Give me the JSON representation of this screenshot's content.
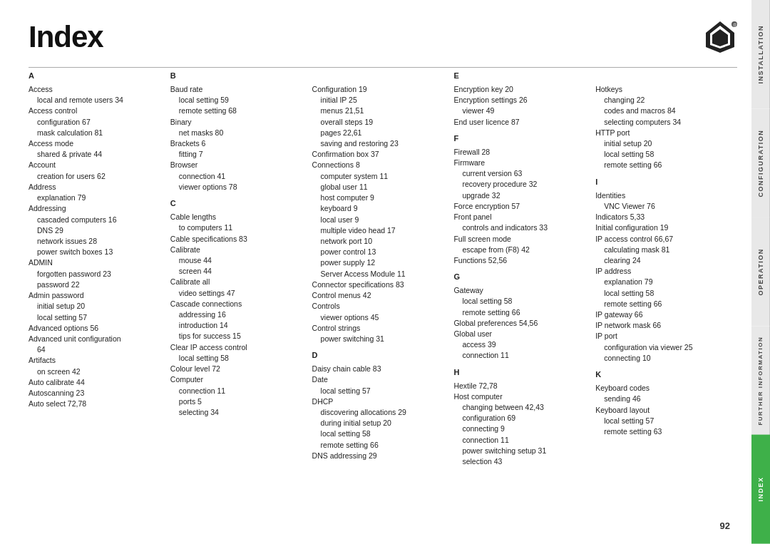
{
  "page": {
    "title": "Index",
    "page_number": "92"
  },
  "tabs": [
    {
      "label": "INSTALLATION",
      "id": "installation",
      "active": false
    },
    {
      "label": "CONFIGURATION",
      "id": "configuration",
      "active": false
    },
    {
      "label": "OPERATION",
      "id": "operation",
      "active": false
    },
    {
      "label": "FURTHER INFORMATION",
      "id": "further-information",
      "active": false
    },
    {
      "label": "INDEX",
      "id": "index",
      "active": true
    }
  ],
  "columns": [
    {
      "id": "col1",
      "sections": [
        {
          "letter": "A",
          "entries": [
            {
              "text": "Access",
              "indent": 0
            },
            {
              "text": "local and remote users  34",
              "indent": 1
            },
            {
              "text": "Access control",
              "indent": 0
            },
            {
              "text": "configuration  67",
              "indent": 1
            },
            {
              "text": "mask calculation  81",
              "indent": 1
            },
            {
              "text": "Access mode",
              "indent": 0
            },
            {
              "text": "shared & private  44",
              "indent": 1
            },
            {
              "text": "Account",
              "indent": 0
            },
            {
              "text": "creation for users  62",
              "indent": 1
            },
            {
              "text": "Address",
              "indent": 0
            },
            {
              "text": "explanation  79",
              "indent": 1
            },
            {
              "text": "Addressing",
              "indent": 0
            },
            {
              "text": "cascaded computers  16",
              "indent": 1
            },
            {
              "text": "DNS  29",
              "indent": 1
            },
            {
              "text": "network issues  28",
              "indent": 1
            },
            {
              "text": "power switch boxes  13",
              "indent": 1
            },
            {
              "text": "ADMIN",
              "indent": 0
            },
            {
              "text": "forgotten password  23",
              "indent": 1
            },
            {
              "text": "password  22",
              "indent": 1
            },
            {
              "text": "Admin password",
              "indent": 0
            },
            {
              "text": "initial setup  20",
              "indent": 1
            },
            {
              "text": "local setting  57",
              "indent": 1
            },
            {
              "text": "Advanced options  56",
              "indent": 0
            },
            {
              "text": "Advanced unit configuration",
              "indent": 0
            },
            {
              "text": "64",
              "indent": 1
            },
            {
              "text": "Artifacts",
              "indent": 0
            },
            {
              "text": "on screen  42",
              "indent": 1
            },
            {
              "text": "Auto calibrate  44",
              "indent": 0
            },
            {
              "text": "Autoscanning  23",
              "indent": 0
            },
            {
              "text": "Auto select  72,78",
              "indent": 0
            }
          ]
        }
      ]
    },
    {
      "id": "col2",
      "sections": [
        {
          "letter": "B",
          "entries": [
            {
              "text": "Baud rate",
              "indent": 0
            },
            {
              "text": "local setting  59",
              "indent": 1
            },
            {
              "text": "remote setting  68",
              "indent": 1
            },
            {
              "text": "Binary",
              "indent": 0
            },
            {
              "text": "net masks  80",
              "indent": 1
            },
            {
              "text": "Brackets  6",
              "indent": 0
            },
            {
              "text": "fitting  7",
              "indent": 1
            },
            {
              "text": "Browser",
              "indent": 0
            },
            {
              "text": "connection  41",
              "indent": 1
            },
            {
              "text": "viewer options  78",
              "indent": 1
            }
          ]
        },
        {
          "letter": "C",
          "entries": [
            {
              "text": "Cable lengths",
              "indent": 0
            },
            {
              "text": "to computers  11",
              "indent": 1
            },
            {
              "text": "Cable specifications  83",
              "indent": 0
            },
            {
              "text": "Calibrate",
              "indent": 0
            },
            {
              "text": "mouse  44",
              "indent": 1
            },
            {
              "text": "screen  44",
              "indent": 1
            },
            {
              "text": "Calibrate all",
              "indent": 0
            },
            {
              "text": "video settings  47",
              "indent": 1
            },
            {
              "text": "Cascade connections",
              "indent": 0
            },
            {
              "text": "addressing  16",
              "indent": 1
            },
            {
              "text": "introduction  14",
              "indent": 1
            },
            {
              "text": "tips for success  15",
              "indent": 1
            },
            {
              "text": "Clear IP access control",
              "indent": 0
            },
            {
              "text": "local setting  58",
              "indent": 1
            },
            {
              "text": "Colour level  72",
              "indent": 0
            },
            {
              "text": "Computer",
              "indent": 0
            },
            {
              "text": "connection  11",
              "indent": 1
            },
            {
              "text": "ports  5",
              "indent": 1
            },
            {
              "text": "selecting  34",
              "indent": 1
            }
          ]
        }
      ]
    },
    {
      "id": "col3",
      "sections": [
        {
          "letter": "",
          "entries": [
            {
              "text": "Configuration  19",
              "indent": 0
            },
            {
              "text": "initial IP  25",
              "indent": 1
            },
            {
              "text": "menus  21,51",
              "indent": 1
            },
            {
              "text": "overall steps  19",
              "indent": 1
            },
            {
              "text": "pages  22,61",
              "indent": 1
            },
            {
              "text": "saving and restoring  23",
              "indent": 1
            },
            {
              "text": "Confirmation box  37",
              "indent": 0
            },
            {
              "text": "Connections  8",
              "indent": 0
            },
            {
              "text": "computer system  11",
              "indent": 1
            },
            {
              "text": "global user  11",
              "indent": 1
            },
            {
              "text": "host computer  9",
              "indent": 1
            },
            {
              "text": "keyboard  9",
              "indent": 1
            },
            {
              "text": "local user  9",
              "indent": 1
            },
            {
              "text": "multiple video head  17",
              "indent": 1
            },
            {
              "text": "network port  10",
              "indent": 1
            },
            {
              "text": "power control  13",
              "indent": 1
            },
            {
              "text": "power supply  12",
              "indent": 1
            },
            {
              "text": "Server Access Module  11",
              "indent": 1
            },
            {
              "text": "Connector specifications  83",
              "indent": 0
            },
            {
              "text": "Control menus  42",
              "indent": 0
            },
            {
              "text": "Controls",
              "indent": 0
            },
            {
              "text": "viewer options  45",
              "indent": 1
            },
            {
              "text": "Control strings",
              "indent": 0
            },
            {
              "text": "power switching  31",
              "indent": 1
            }
          ]
        },
        {
          "letter": "D",
          "entries": [
            {
              "text": "Daisy chain cable  83",
              "indent": 0
            },
            {
              "text": "Date",
              "indent": 0
            },
            {
              "text": "local setting  57",
              "indent": 1
            },
            {
              "text": "DHCP",
              "indent": 0
            },
            {
              "text": "discovering allocations  29",
              "indent": 1
            },
            {
              "text": "during initial setup  20",
              "indent": 1
            },
            {
              "text": "local setting  58",
              "indent": 1
            },
            {
              "text": "remote setting  66",
              "indent": 1
            },
            {
              "text": "DNS addressing  29",
              "indent": 0
            }
          ]
        }
      ]
    },
    {
      "id": "col4",
      "sections": [
        {
          "letter": "E",
          "entries": [
            {
              "text": "Encryption key  20",
              "indent": 0
            },
            {
              "text": "Encryption settings  26",
              "indent": 0
            },
            {
              "text": "viewer  49",
              "indent": 1
            },
            {
              "text": "End user licence  87",
              "indent": 0
            }
          ]
        },
        {
          "letter": "F",
          "entries": [
            {
              "text": "Firewall  28",
              "indent": 0
            },
            {
              "text": "Firmware",
              "indent": 0
            },
            {
              "text": "current version  63",
              "indent": 1
            },
            {
              "text": "recovery procedure  32",
              "indent": 1
            },
            {
              "text": "upgrade  32",
              "indent": 1
            },
            {
              "text": "Force encryption  57",
              "indent": 0
            },
            {
              "text": "Front panel",
              "indent": 0
            },
            {
              "text": "controls and indicators  33",
              "indent": 1
            },
            {
              "text": "Full screen mode",
              "indent": 0
            },
            {
              "text": "escape from (F8)  42",
              "indent": 1
            },
            {
              "text": "Functions  52,56",
              "indent": 0
            }
          ]
        },
        {
          "letter": "G",
          "entries": [
            {
              "text": "Gateway",
              "indent": 0
            },
            {
              "text": "local setting  58",
              "indent": 1
            },
            {
              "text": "remote setting  66",
              "indent": 1
            },
            {
              "text": "Global preferences  54,56",
              "indent": 0
            },
            {
              "text": "Global user",
              "indent": 0
            },
            {
              "text": "access  39",
              "indent": 1
            },
            {
              "text": "connection  11",
              "indent": 1
            }
          ]
        },
        {
          "letter": "H",
          "entries": [
            {
              "text": "Hextile  72,78",
              "indent": 0
            },
            {
              "text": "Host computer",
              "indent": 0
            },
            {
              "text": "changing between  42,43",
              "indent": 1
            },
            {
              "text": "configuration  69",
              "indent": 1
            },
            {
              "text": "connecting  9",
              "indent": 1
            },
            {
              "text": "connection  11",
              "indent": 1
            },
            {
              "text": "power switching setup  31",
              "indent": 1
            },
            {
              "text": "selection  43",
              "indent": 1
            }
          ]
        }
      ]
    },
    {
      "id": "col5",
      "sections": [
        {
          "letter": "",
          "entries": [
            {
              "text": "Hotkeys",
              "indent": 0
            },
            {
              "text": "changing  22",
              "indent": 1
            },
            {
              "text": "codes and macros  84",
              "indent": 1
            },
            {
              "text": "selecting computers  34",
              "indent": 1
            },
            {
              "text": "HTTP port",
              "indent": 0
            },
            {
              "text": "initial setup  20",
              "indent": 1
            },
            {
              "text": "local setting  58",
              "indent": 1
            },
            {
              "text": "remote setting  66",
              "indent": 1
            }
          ]
        },
        {
          "letter": "I",
          "entries": [
            {
              "text": "Identities",
              "indent": 0
            },
            {
              "text": "VNC Viewer  76",
              "indent": 1
            },
            {
              "text": "Indicators  5,33",
              "indent": 0
            },
            {
              "text": "Initial configuration  19",
              "indent": 0
            },
            {
              "text": "IP access control  66,67",
              "indent": 0
            },
            {
              "text": "calculating mask  81",
              "indent": 1
            },
            {
              "text": "clearing  24",
              "indent": 1
            },
            {
              "text": "IP address",
              "indent": 0
            },
            {
              "text": "explanation  79",
              "indent": 1
            },
            {
              "text": "local setting  58",
              "indent": 1
            },
            {
              "text": "remote setting  66",
              "indent": 1
            },
            {
              "text": "IP gateway  66",
              "indent": 0
            },
            {
              "text": "IP network mask  66",
              "indent": 0
            },
            {
              "text": "IP port",
              "indent": 0
            },
            {
              "text": "configuration via viewer  25",
              "indent": 1
            },
            {
              "text": "connecting  10",
              "indent": 1
            }
          ]
        },
        {
          "letter": "K",
          "entries": [
            {
              "text": "Keyboard codes",
              "indent": 0
            },
            {
              "text": "sending  46",
              "indent": 1
            },
            {
              "text": "Keyboard layout",
              "indent": 0
            },
            {
              "text": "local setting  57",
              "indent": 1
            },
            {
              "text": "remote setting  63",
              "indent": 1
            }
          ]
        }
      ]
    }
  ]
}
